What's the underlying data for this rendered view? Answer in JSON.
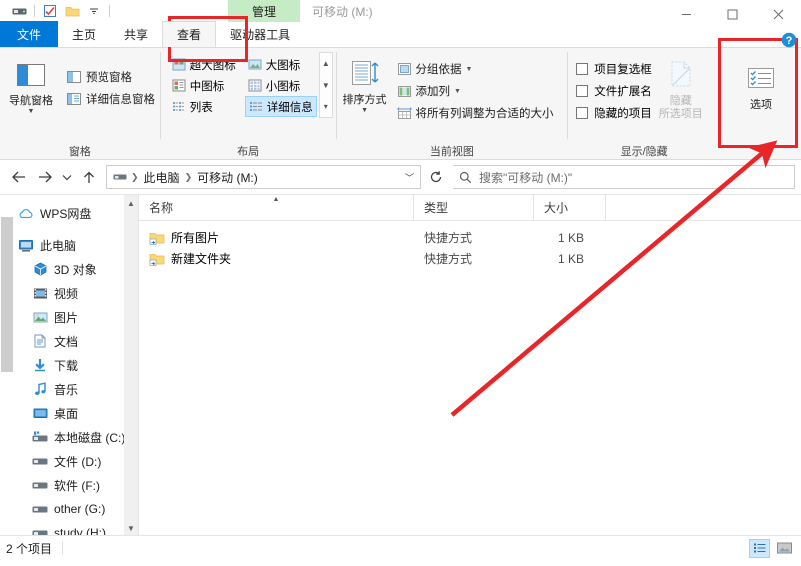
{
  "window": {
    "title": "可移动 (M:)",
    "contextual_tab": "管理",
    "quick_access": [
      "drive-icon",
      "properties-icon",
      "new-folder-icon",
      "customize-caret"
    ],
    "controls": {
      "minimize": "minimize-icon",
      "maximize": "maximize-icon",
      "close": "close-icon",
      "help": "help-icon"
    }
  },
  "tabs": [
    {
      "label": "文件",
      "state": "file"
    },
    {
      "label": "主页",
      "state": "normal"
    },
    {
      "label": "共享",
      "state": "normal"
    },
    {
      "label": "查看",
      "state": "active"
    },
    {
      "label": "驱动器工具",
      "state": "contextual"
    }
  ],
  "ribbon": {
    "groups": [
      {
        "label": "窗格",
        "big": {
          "label": "导航窗格",
          "icon": "nav-pane-icon",
          "has_dropdown": true
        },
        "items": [
          {
            "label": "预览窗格",
            "icon": "preview-pane-icon"
          },
          {
            "label": "详细信息窗格",
            "icon": "details-pane-icon"
          }
        ]
      },
      {
        "label": "布局",
        "gallery": [
          {
            "label": "超大图标",
            "icon": "extra-large-icons-icon",
            "selected": false
          },
          {
            "label": "大图标",
            "icon": "large-icons-icon",
            "selected": false
          },
          {
            "label": "中图标",
            "icon": "medium-icons-icon",
            "selected": false
          },
          {
            "label": "小图标",
            "icon": "small-icons-icon",
            "selected": false
          },
          {
            "label": "列表",
            "icon": "list-icon",
            "selected": false
          },
          {
            "label": "详细信息",
            "icon": "details-icon",
            "selected": true
          }
        ]
      },
      {
        "label": "当前视图",
        "big": {
          "label": "排序方式",
          "icon": "sort-by-icon",
          "has_dropdown": true
        },
        "items": [
          {
            "label": "分组依据",
            "icon": "group-by-icon",
            "has_dropdown": true
          },
          {
            "label": "添加列",
            "icon": "add-columns-icon",
            "has_dropdown": true
          },
          {
            "label": "将所有列调整为合适的大小",
            "icon": "size-all-columns-icon",
            "has_dropdown": false
          }
        ]
      },
      {
        "label": "显示/隐藏",
        "checkboxes": [
          {
            "label": "项目复选框",
            "checked": false
          },
          {
            "label": "文件扩展名",
            "checked": false
          },
          {
            "label": "隐藏的项目",
            "checked": false
          }
        ],
        "hide_button": {
          "line1": "隐藏",
          "line2": "所选项目",
          "icon": "hide-selected-icon",
          "disabled": true
        }
      },
      {
        "label": "",
        "options_button": {
          "label": "选项",
          "icon": "options-icon"
        }
      }
    ]
  },
  "addressbar": {
    "back": "back-arrow-icon",
    "forward": "forward-arrow-icon",
    "recent": "recent-locations-icon",
    "up": "up-arrow-icon",
    "breadcrumb": [
      {
        "label": "",
        "icon": "drive-icon"
      },
      {
        "label": "此电脑"
      },
      {
        "label": "可移动 (M:)"
      }
    ],
    "dropdown": "chevron-down-icon",
    "refresh": "refresh-icon",
    "search_placeholder": "搜索\"可移动 (M:)\"",
    "search_value": "",
    "search_icon": "search-icon"
  },
  "sidebar": {
    "items": [
      {
        "label": "WPS网盘",
        "icon": "cloud-icon",
        "indent": 0
      },
      {
        "label": "此电脑",
        "icon": "this-pc-icon",
        "indent": 0
      },
      {
        "label": "3D 对象",
        "icon": "3d-objects-icon",
        "indent": 1
      },
      {
        "label": "视频",
        "icon": "videos-icon",
        "indent": 1
      },
      {
        "label": "图片",
        "icon": "pictures-icon",
        "indent": 1
      },
      {
        "label": "文档",
        "icon": "documents-icon",
        "indent": 1
      },
      {
        "label": "下载",
        "icon": "downloads-icon",
        "indent": 1
      },
      {
        "label": "音乐",
        "icon": "music-icon",
        "indent": 1
      },
      {
        "label": "桌面",
        "icon": "desktop-icon",
        "indent": 1
      },
      {
        "label": "本地磁盘 (C:)",
        "icon": "system-drive-icon",
        "indent": 1
      },
      {
        "label": "文件 (D:)",
        "icon": "drive-icon",
        "indent": 1
      },
      {
        "label": "软件 (F:)",
        "icon": "drive-icon",
        "indent": 1
      },
      {
        "label": "other (G:)",
        "icon": "drive-icon",
        "indent": 1
      },
      {
        "label": "study (H:)",
        "icon": "drive-icon",
        "indent": 1
      }
    ]
  },
  "filelist": {
    "columns": [
      {
        "label": "名称",
        "sorted": "asc"
      },
      {
        "label": "类型",
        "sorted": ""
      },
      {
        "label": "大小",
        "sorted": ""
      }
    ],
    "rows": [
      {
        "name": "所有图片",
        "icon": "folder-shortcut-icon",
        "type": "快捷方式",
        "size": "1 KB"
      },
      {
        "name": "新建文件夹",
        "icon": "folder-shortcut-icon",
        "type": "快捷方式",
        "size": "1 KB"
      }
    ]
  },
  "statusbar": {
    "count_text": "2 个项目",
    "views": [
      {
        "name": "details-view-button",
        "active": true
      },
      {
        "name": "large-icons-view-button",
        "active": false
      }
    ]
  },
  "annotations": {
    "highlight_color": "#e8262a",
    "boxes": [
      "查看-tab-highlight",
      "选项-button-highlight"
    ],
    "arrow": "arrow-pointing-to-options-button"
  }
}
